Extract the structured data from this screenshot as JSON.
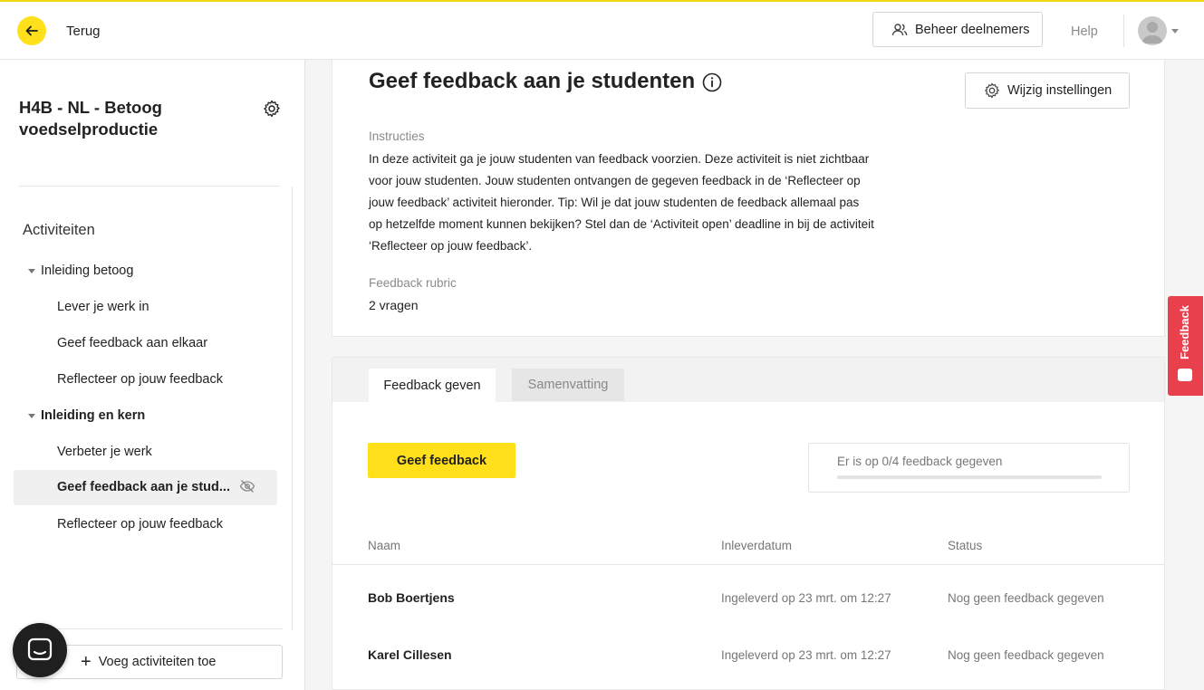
{
  "topbar": {
    "back_label": "Terug",
    "manage_label": "Beheer deelnemers",
    "help_label": "Help"
  },
  "sidebar": {
    "course_title": "H4B - NL - Betoog voedselproductie",
    "activities_heading": "Activiteiten",
    "groups": [
      {
        "label": "Inleiding betoog",
        "items": [
          "Lever je werk in",
          "Geef feedback aan elkaar",
          "Reflecteer op jouw feedback"
        ]
      },
      {
        "label": "Inleiding en kern",
        "items": [
          "Verbeter je werk",
          "Geef feedback aan je stud...",
          "Reflecteer op jouw feedback"
        ]
      }
    ],
    "add_label": "Voeg activiteiten toe"
  },
  "main": {
    "title": "Geef feedback aan je studenten",
    "settings_label": "Wijzig instellingen",
    "instructions_label": "Instructies",
    "instructions_text": "In deze activiteit ga je jouw studenten van feedback voorzien. Deze activiteit is niet zichtbaar voor jouw studenten. Jouw studenten ontvangen de gegeven feedback in de ‘Reflecteer op jouw feedback’ activiteit hieronder. Tip: Wil je dat jouw studenten de feedback allemaal pas op hetzelfde moment kunnen bekijken? Stel dan de ‘Activiteit open’ deadline in bij de activiteit ‘Reflecteer op jouw feedback’.",
    "rubric_label": "Feedback rubric",
    "rubric_value": "2 vragen",
    "tabs": [
      "Feedback geven",
      "Samenvatting"
    ],
    "give_button": "Geef feedback",
    "progress_text": "Er is op 0/4 feedback gegeven",
    "progress_fraction": 0,
    "table": {
      "headers": [
        "Naam",
        "Inleverdatum",
        "Status"
      ],
      "rows": [
        {
          "name": "Bob Boertjens",
          "date": "Ingeleverd op 23 mrt. om 12:27",
          "status": "Nog geen feedback gegeven"
        },
        {
          "name": "Karel Cillesen",
          "date": "Ingeleverd op 23 mrt. om 12:27",
          "status": "Nog geen feedback gegeven"
        }
      ]
    }
  },
  "feedback_tab": {
    "label": "Feedback"
  },
  "colors": {
    "accent": "#ffe01b",
    "feedback_tab": "#e8404d"
  }
}
